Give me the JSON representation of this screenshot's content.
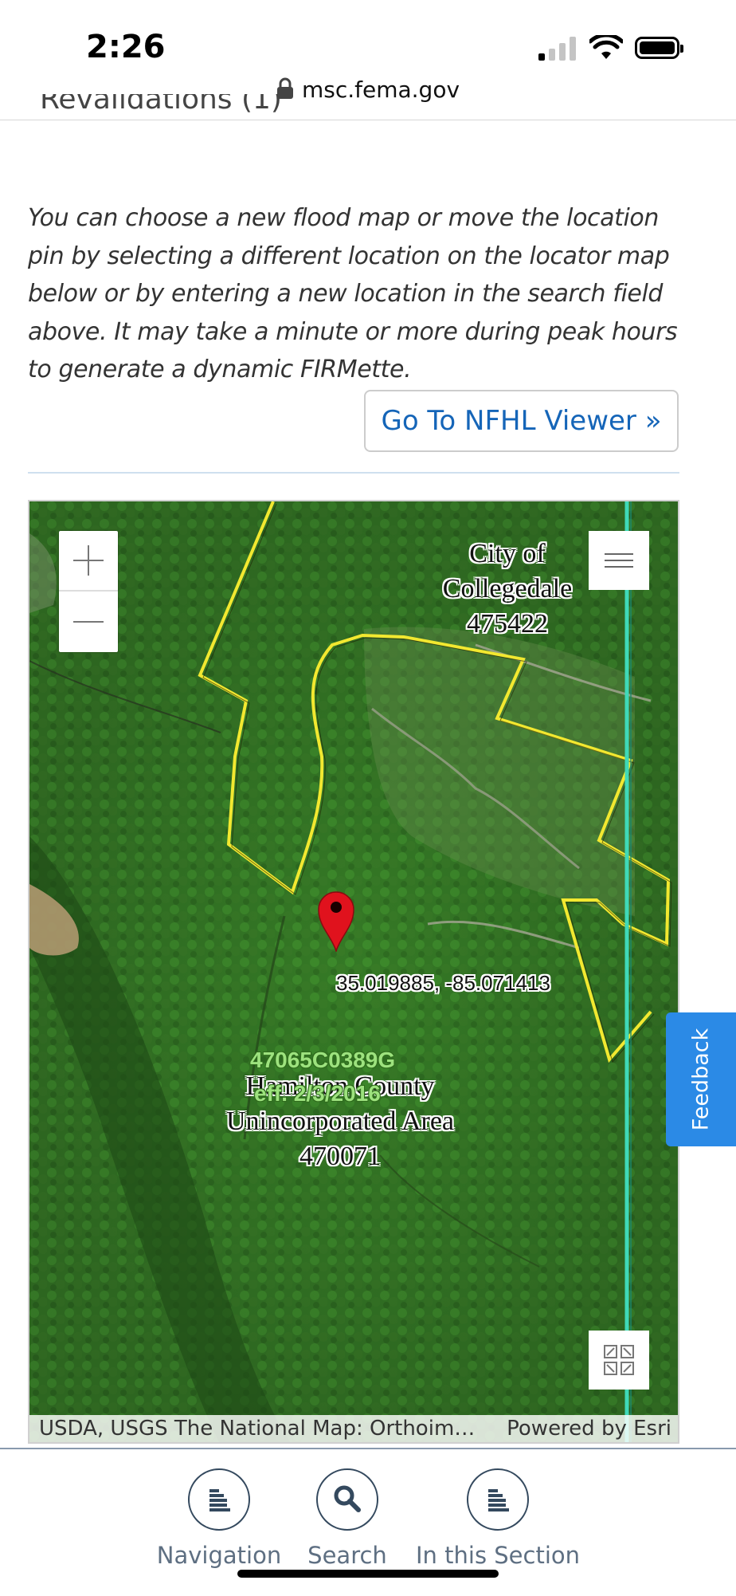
{
  "status_bar": {
    "time": "2:26",
    "icons": [
      "cellular-signal-icon",
      "wifi-icon",
      "battery-icon"
    ]
  },
  "browser": {
    "url": "msc.fema.gov",
    "lock_icon": "lock-icon"
  },
  "previous_line_cutoff": "Revalidations (1)",
  "info_text": "You can choose a new flood map or move the location pin by selecting a different location on the locator map below or by entering a new location in the search field above. It may take a minute or more during peak hours to generate a dynamic FIRMette.",
  "nfhl_button_label": "Go To NFHL Viewer »",
  "map": {
    "zoom_in_icon": "plus-icon",
    "zoom_out_icon": "minus-icon",
    "layers_icon": "list-icon",
    "overview_icon": "overview-map-icon",
    "city_label": {
      "line1": "City of",
      "line2": "Collegedale",
      "line3": "475422"
    },
    "county_label": {
      "line1": "Hamilton County",
      "line2": "Unincorporated Area",
      "line3": "470071"
    },
    "coordinates": "35.019885, -85.071413",
    "panel_id": "47065C0389G",
    "panel_effective": "eff. 2/3/2016",
    "attribution_left": "USDA, USGS The National Map: Orthoim…",
    "attribution_right": "Powered by Esri",
    "colors": {
      "boundary": "#f2e830",
      "panel_line": "#3fd9b8",
      "marker": "#e0121d",
      "panel_text": "#9de27e"
    }
  },
  "feedback_label": "Feedback",
  "bottom_nav": [
    {
      "label": "Navigation",
      "icon": "menu-stack-icon"
    },
    {
      "label": "Search",
      "icon": "search-icon"
    },
    {
      "label": "In this Section",
      "icon": "menu-stack-icon"
    }
  ]
}
